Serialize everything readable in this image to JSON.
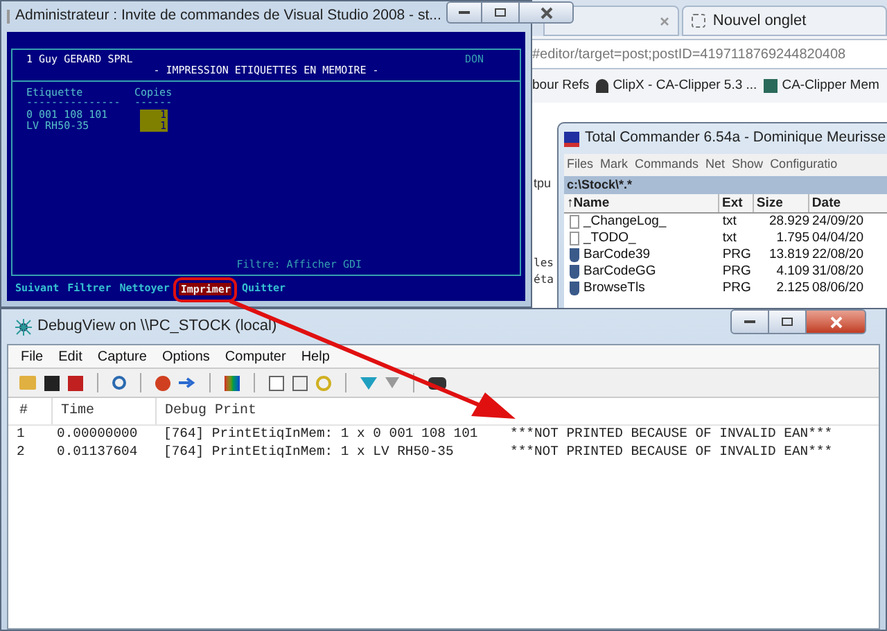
{
  "browser": {
    "tab": {
      "label": "Nouvel onglet"
    },
    "address": "#editor/target=post;postID=4197118769244820408",
    "bookmarks": [
      "bour Refs",
      "ClipX - CA-Clipper 5.3 ...",
      "CA-Clipper Mem"
    ],
    "page_snippets": [
      "tpu",
      "les",
      "éta"
    ]
  },
  "console": {
    "title": "Administrateur : Invite de commandes de Visual Studio 2008 - st...",
    "company": "1 Guy GERARD SPRL",
    "user": "DON",
    "heading": "- IMPRESSION ETIQUETTES EN MEMOIRE -",
    "columns": [
      "Etiquette",
      "Copies"
    ],
    "underline": [
      "---------------",
      "------"
    ],
    "rows": [
      {
        "label": "0 001 108 101",
        "copies": "1"
      },
      {
        "label": "LV RH50-35",
        "copies": "1"
      }
    ],
    "filter": "Filtre: Afficher GDI",
    "menu": [
      {
        "label": "Suivant",
        "selected": false
      },
      {
        "label": "Filtrer",
        "selected": false
      },
      {
        "label": "Nettoyer",
        "selected": false
      },
      {
        "label": "Imprimer",
        "selected": true
      },
      {
        "label": "Quitter",
        "selected": false
      }
    ]
  },
  "total_commander": {
    "title": "Total Commander 6.54a - Dominique Meurisse",
    "menu": [
      "Files",
      "Mark",
      "Commands",
      "Net",
      "Show",
      "Configuratio"
    ],
    "path": "c:\\Stock\\*.*",
    "columns": [
      "↑Name",
      "Ext",
      "Size",
      "Date"
    ],
    "rows": [
      {
        "name": "_ChangeLog_",
        "ext": "txt",
        "size": "28.929",
        "date": "24/09/20",
        "kind": "text"
      },
      {
        "name": "_TODO_",
        "ext": "txt",
        "size": "1.795",
        "date": "04/04/20",
        "kind": "text"
      },
      {
        "name": "BarCode39",
        "ext": "PRG",
        "size": "13.819",
        "date": "22/08/20",
        "kind": "program"
      },
      {
        "name": "BarCodeGG",
        "ext": "PRG",
        "size": "4.109",
        "date": "31/08/20",
        "kind": "program"
      },
      {
        "name": "BrowseTls",
        "ext": "PRG",
        "size": "2.125",
        "date": "08/06/20",
        "kind": "program"
      }
    ]
  },
  "debugview": {
    "title": "DebugView on \\\\PC_STOCK (local)",
    "menu": [
      "File",
      "Edit",
      "Capture",
      "Options",
      "Computer",
      "Help"
    ],
    "columns": [
      "#",
      "Time",
      "Debug Print"
    ],
    "rows": [
      {
        "index": "1",
        "time": "0.00000000",
        "message": "[764] PrintEtiqInMem: 1 x 0 001 108 101",
        "result": "***NOT PRINTED BECAUSE OF INVALID EAN***"
      },
      {
        "index": "2",
        "time": "0.01137604",
        "message": "[764] PrintEtiqInMem: 1 x LV RH50-35",
        "result": "***NOT PRINTED BECAUSE OF INVALID EAN***"
      }
    ]
  }
}
